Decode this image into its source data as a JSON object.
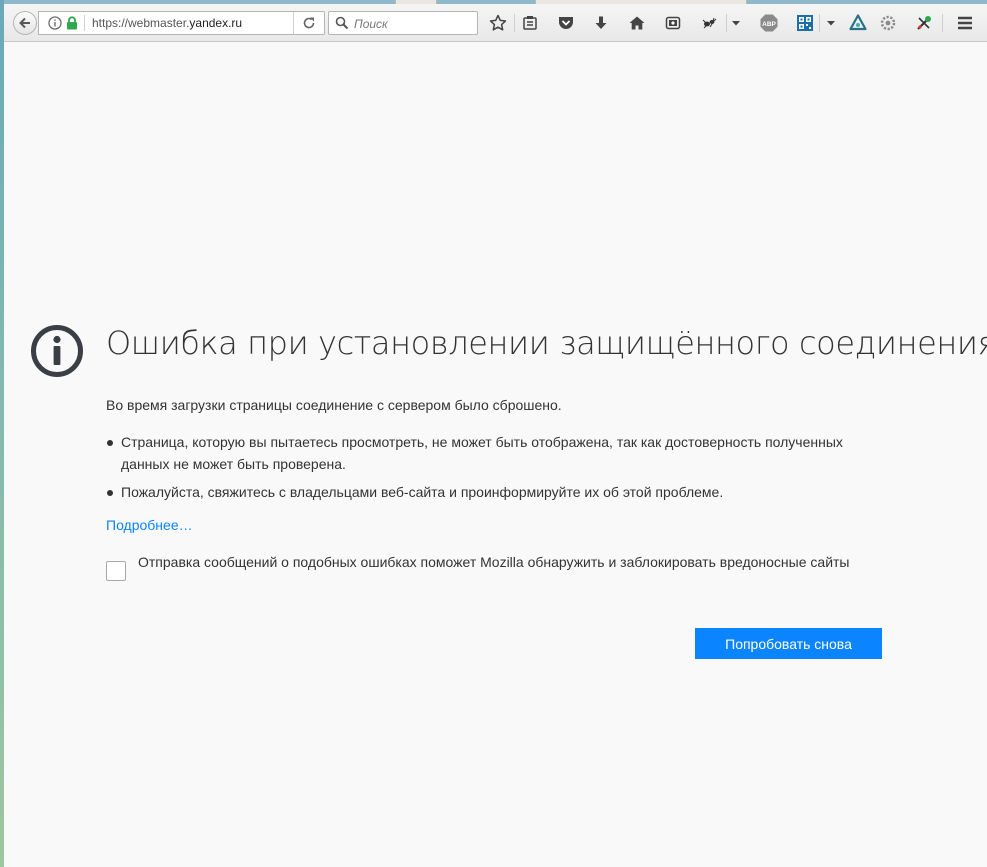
{
  "browser": {
    "url_prefix": "https://webmaster.",
    "url_domain": "yandex.ru",
    "search_placeholder": "Поиск",
    "adblock_label": "ABP"
  },
  "error_page": {
    "title": "Ошибка при установлении защищённого соединения",
    "description": "Во время загрузки страницы соединение с сервером было сброшено.",
    "bullets": [
      "Страница, которую вы пытаетесь просмотреть, не может быть отображена, так как достоверность полученных данных не может быть проверена.",
      "Пожалуйста, свяжитесь с владельцами веб-сайта и проинформируйте их об этой проблеме."
    ],
    "more_link": "Подробнее…",
    "report_checkbox_label": "Отправка сообщений о подобных ошибках поможет Mozilla обнаружить и заблокировать вредоносные сайты",
    "report_checked": false,
    "retry_button": "Попробовать снова"
  },
  "colors": {
    "accent": "#0a84ff",
    "page_background": "#f9f9fa",
    "text": "#333333",
    "secure_lock": "#2fa84f"
  }
}
